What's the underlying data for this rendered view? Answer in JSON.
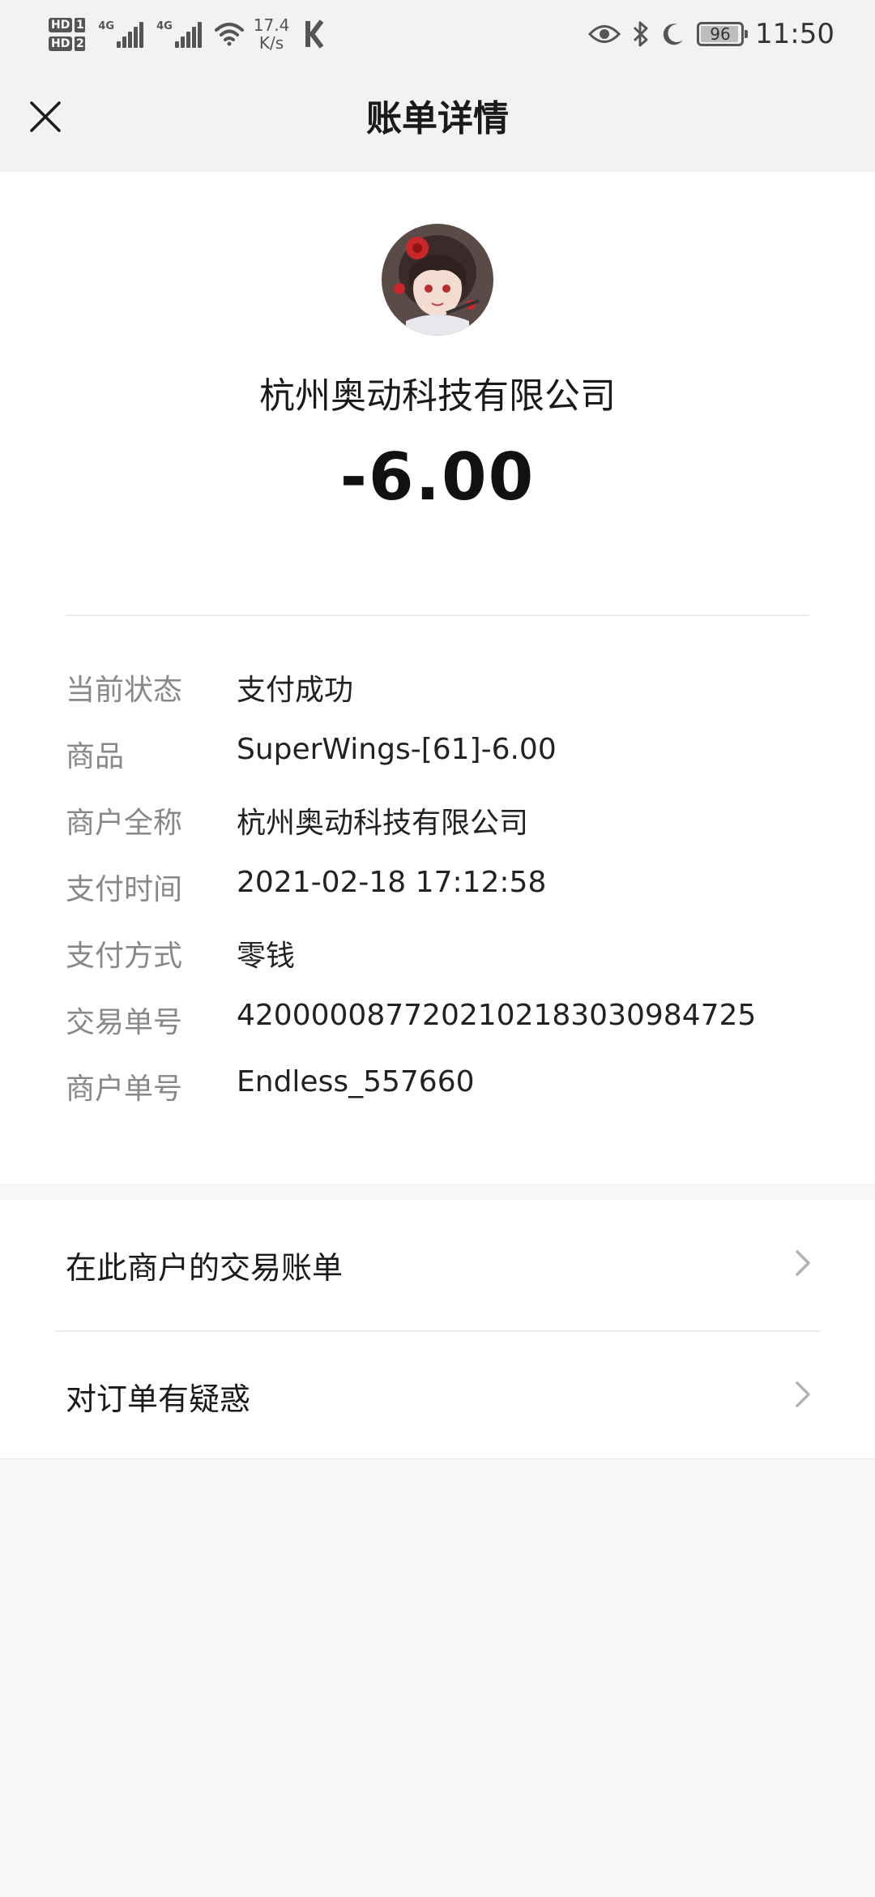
{
  "status_bar": {
    "hd1": "HD",
    "hd1_num": "1",
    "hd2": "HD",
    "hd2_num": "2",
    "net1": "4G",
    "net2": "4G",
    "speed_value": "17.4",
    "speed_unit": "K/s",
    "battery": "96",
    "time": "11:50"
  },
  "navbar": {
    "title": "账单详情",
    "close_icon": "close-icon"
  },
  "summary": {
    "merchant": "杭州奥动科技有限公司",
    "amount": "-6.00"
  },
  "details": [
    {
      "key": "当前状态",
      "value": "支付成功"
    },
    {
      "key": "商品",
      "value": "SuperWings-[61]-6.00"
    },
    {
      "key": "商户全称",
      "value": "杭州奥动科技有限公司"
    },
    {
      "key": "支付时间",
      "value": "2021-02-18 17:12:58"
    },
    {
      "key": "支付方式",
      "value": "零钱"
    },
    {
      "key": "交易单号",
      "value": "4200000877202102183030984725"
    },
    {
      "key": "商户单号",
      "value": "Endless_557660"
    }
  ],
  "actions": [
    {
      "label": "在此商户的交易账单"
    },
    {
      "label": "对订单有疑惑"
    }
  ],
  "colors": {
    "background": "#f7f7f7",
    "nav_bg": "#f2f2f2",
    "label_gray": "#888888",
    "text": "#1a1a1a"
  }
}
